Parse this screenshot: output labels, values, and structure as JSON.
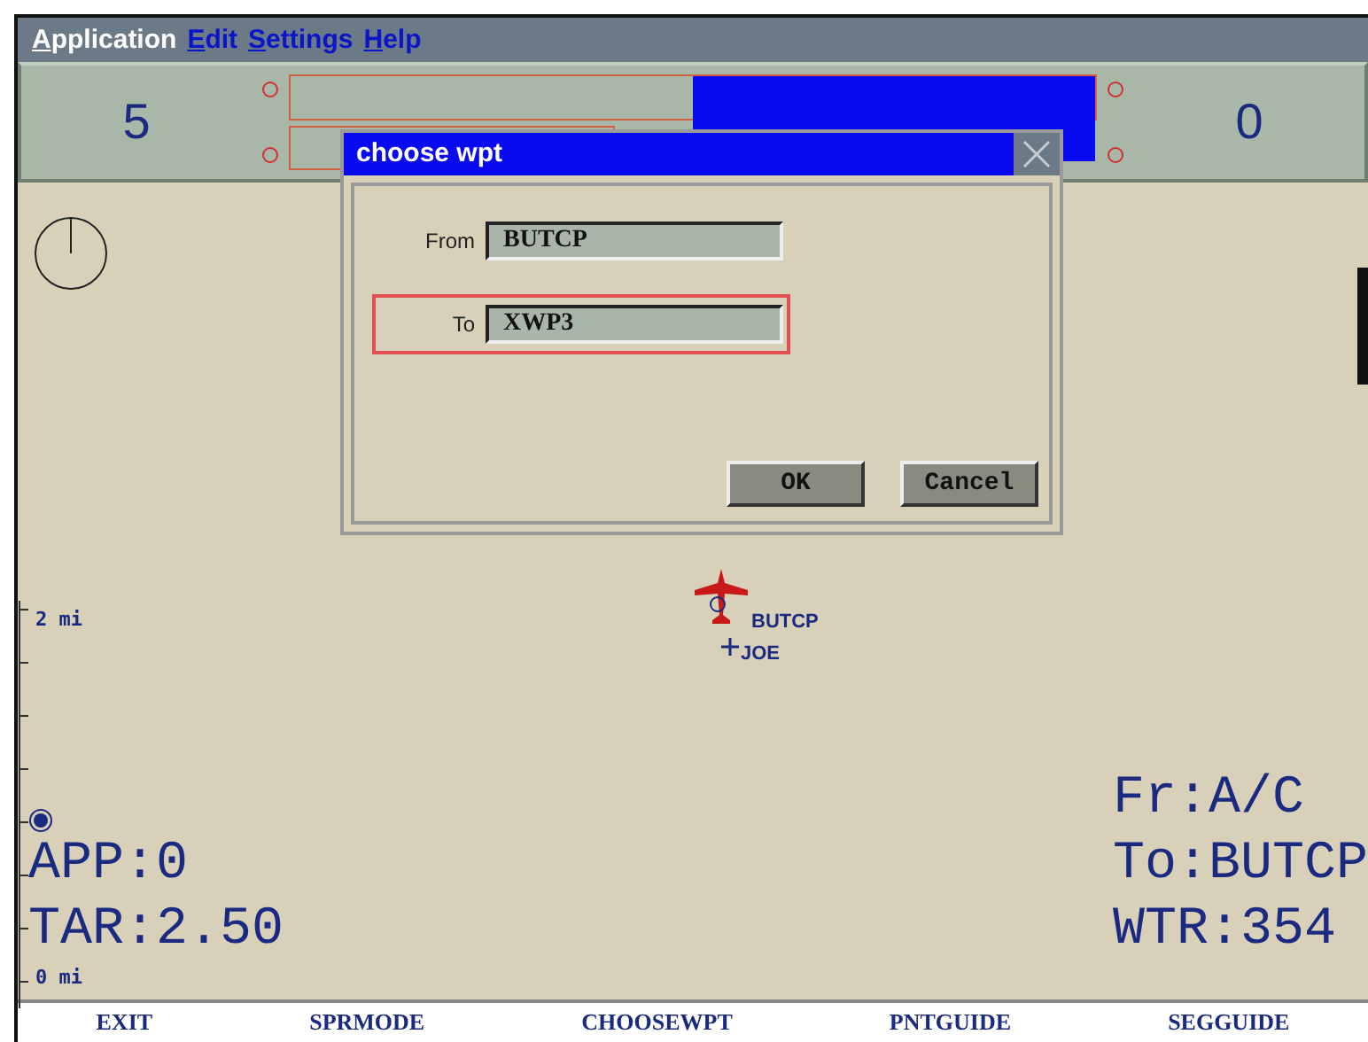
{
  "menu": [
    {
      "label": "Application",
      "selected": true
    },
    {
      "label": "Edit",
      "selected": false
    },
    {
      "label": "Settings",
      "selected": false
    },
    {
      "label": "Help",
      "selected": false
    }
  ],
  "header": {
    "left_value": "5",
    "right_value": "0",
    "bar": {
      "level": 0.5
    }
  },
  "map": {
    "scale_labels": [
      "2 mi",
      "0 mi"
    ],
    "waypoints": [
      {
        "label": "BUTCP",
        "kind": "aircraft"
      },
      {
        "label": "JOE",
        "kind": "point"
      }
    ],
    "left_readouts": [
      "APP:0",
      "TAR:2.50"
    ],
    "right_readouts": [
      "Fr:A/C",
      "To:BUTCP",
      "WTR:354"
    ]
  },
  "dialog": {
    "title": "choose wpt",
    "fields": [
      {
        "label": "From",
        "value": "BUTCP",
        "focused": false
      },
      {
        "label": "To",
        "value": "XWP3",
        "focused": true
      }
    ],
    "buttons": [
      "OK",
      "Cancel"
    ]
  },
  "function_keys": [
    "EXIT",
    "SPRMODE",
    "CHOOSEWPT",
    "PNTGUIDE",
    "SEGGUIDE"
  ]
}
